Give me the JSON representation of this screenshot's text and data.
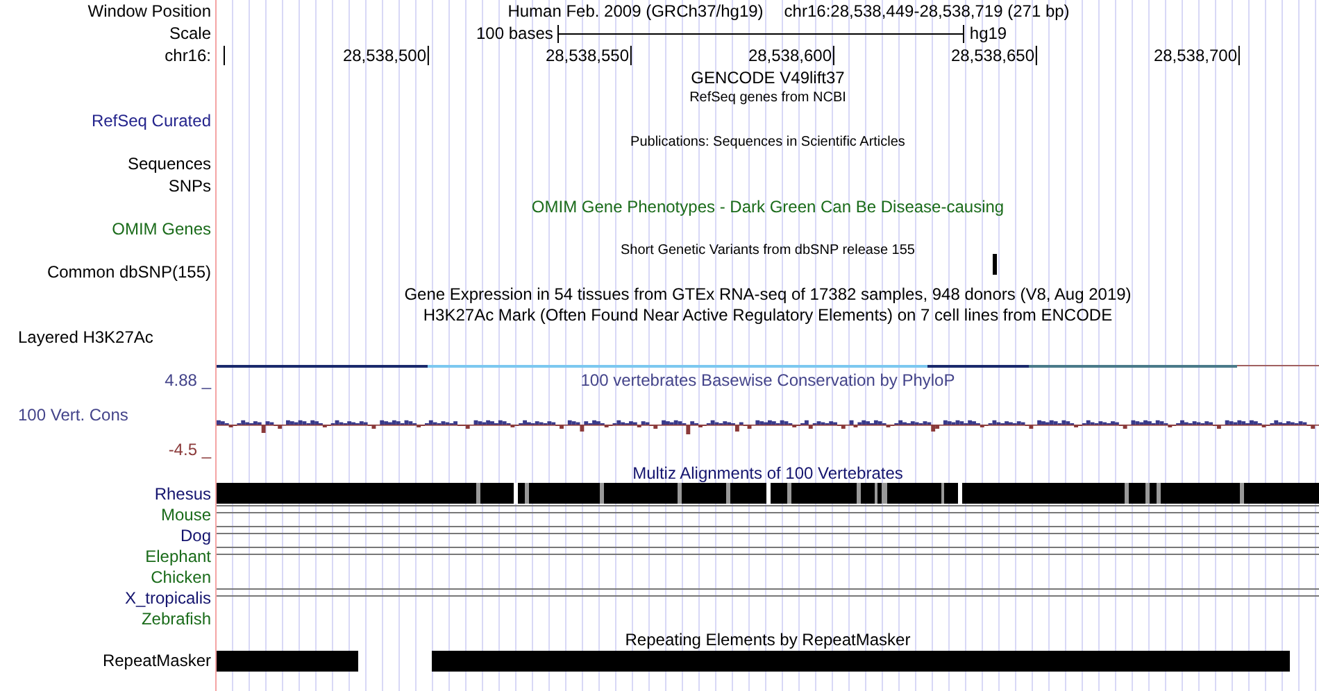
{
  "header": {
    "position_label": "Window Position",
    "assembly": "Human Feb. 2009 (GRCh37/hg19)",
    "position": "chr16:28,538,449-28,538,719 (271 bp)",
    "scale_label": "Scale",
    "scale_text": "100 bases",
    "scale_db": "hg19",
    "chrom_label": "chr16:",
    "ticks": [
      "28,538,500",
      "28,538,550",
      "28,538,600",
      "28,538,650",
      "28,538,700"
    ]
  },
  "tracks": [
    {
      "kind": "title",
      "text": "GENCODE V49lift37",
      "small": false,
      "color": "#000000"
    },
    {
      "kind": "title",
      "text": "RefSeq genes from NCBI",
      "small": true,
      "color": "#000000"
    },
    {
      "kind": "label",
      "text": "RefSeq Curated",
      "color": "#24248c"
    },
    {
      "kind": "title",
      "text": "Publications: Sequences in Scientific Articles",
      "small": true,
      "color": "#000000"
    },
    {
      "kind": "label",
      "text": "Sequences",
      "color": "#000000"
    },
    {
      "kind": "label",
      "text": "SNPs",
      "color": "#000000"
    },
    {
      "kind": "title",
      "text": "OMIM Gene Phenotypes - Dark Green Can Be Disease-causing",
      "small": false,
      "color": "#1a6b1a"
    },
    {
      "kind": "label",
      "text": "OMIM Genes",
      "color": "#1a6b1a"
    },
    {
      "kind": "title",
      "text": "Short Genetic Variants from dbSNP release 155",
      "small": true,
      "color": "#000000"
    },
    {
      "kind": "snp",
      "text": "Common dbSNP(155)",
      "color": "#000000"
    },
    {
      "kind": "title",
      "text": "Gene Expression in 54 tissues from GTEx RNA-seq of 17382 samples, 948 donors (V8, Aug 2019)",
      "small": false,
      "color": "#000000"
    },
    {
      "kind": "title",
      "text": "H3K27Ac Mark (Often Found Near Active Regulatory Elements) on 7 cell lines from ENCODE",
      "small": false,
      "color": "#000000"
    },
    {
      "kind": "composite",
      "text": "Layered H3K27Ac",
      "color": "#000000"
    }
  ],
  "conservation": {
    "title": "100 vertebrates Basewise Conservation by PhyloP",
    "label": "100 Vert. Cons",
    "max": "4.88 _",
    "min": "-4.5 _"
  },
  "alignment": {
    "title": "Multiz Alignments of 100 Vertebrates",
    "species": [
      {
        "name": "Rhesus",
        "kind": "block",
        "color": "#14146e"
      },
      {
        "name": "Mouse",
        "kind": "lines",
        "color": "#1a6b1a"
      },
      {
        "name": "Dog",
        "kind": "lines",
        "color": "#14146e"
      },
      {
        "name": "Elephant",
        "kind": "lines",
        "color": "#1a6b1a"
      },
      {
        "name": "Chicken",
        "kind": "empty",
        "color": "#1a6b1a"
      },
      {
        "name": "X_tropicalis",
        "kind": "lines",
        "color": "#14146e"
      },
      {
        "name": "Zebrafish",
        "kind": "empty",
        "color": "#1a6b1a"
      }
    ]
  },
  "repeats": {
    "title": "Repeating Elements by RepeatMasker",
    "label": "RepeatMasker"
  }
}
